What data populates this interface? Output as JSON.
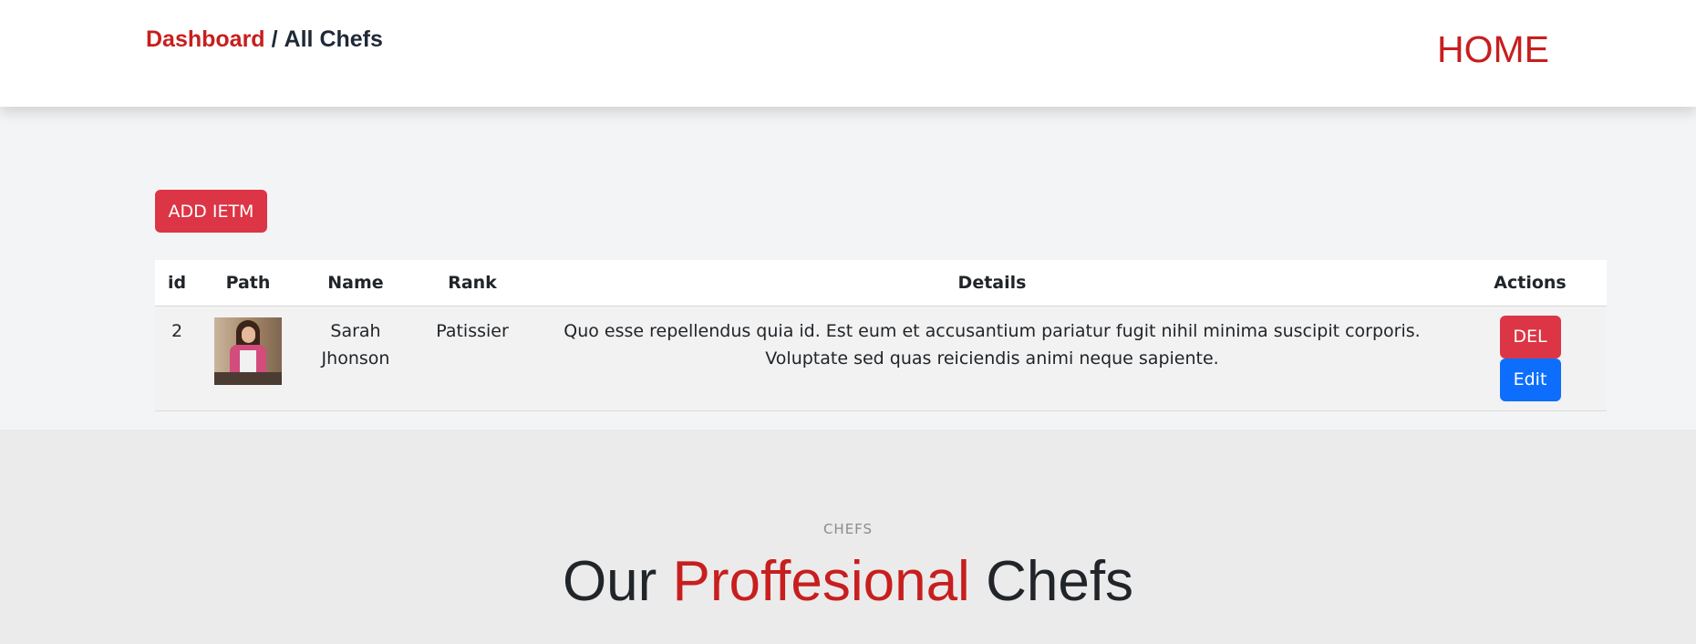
{
  "header": {
    "breadcrumb": {
      "link": "Dashboard",
      "separator": "/",
      "current": "All Chefs"
    },
    "home_label": "HOME"
  },
  "toolbar": {
    "add_label": "ADD IETM"
  },
  "table": {
    "columns": [
      "id",
      "Path",
      "Name",
      "Rank",
      "Details",
      "Actions"
    ],
    "rows": [
      {
        "id": "2",
        "path_image": "chef-photo",
        "name": "Sarah Jhonson",
        "rank": "Patissier",
        "details": "Quo esse repellendus quia id. Est eum et accusantium pariatur fugit nihil minima suscipit corporis. Voluptate sed quas reiciendis animi neque sapiente.",
        "actions": {
          "delete_label": "DEL",
          "edit_label": "Edit"
        }
      }
    ]
  },
  "chefs_section": {
    "kicker": "CHEFS",
    "title_part1": "Our",
    "title_accent": "Proffesional",
    "title_part2": "Chefs"
  },
  "colors": {
    "accent_red": "#c81e1e",
    "danger": "#dc3545",
    "primary": "#0d6efd"
  }
}
